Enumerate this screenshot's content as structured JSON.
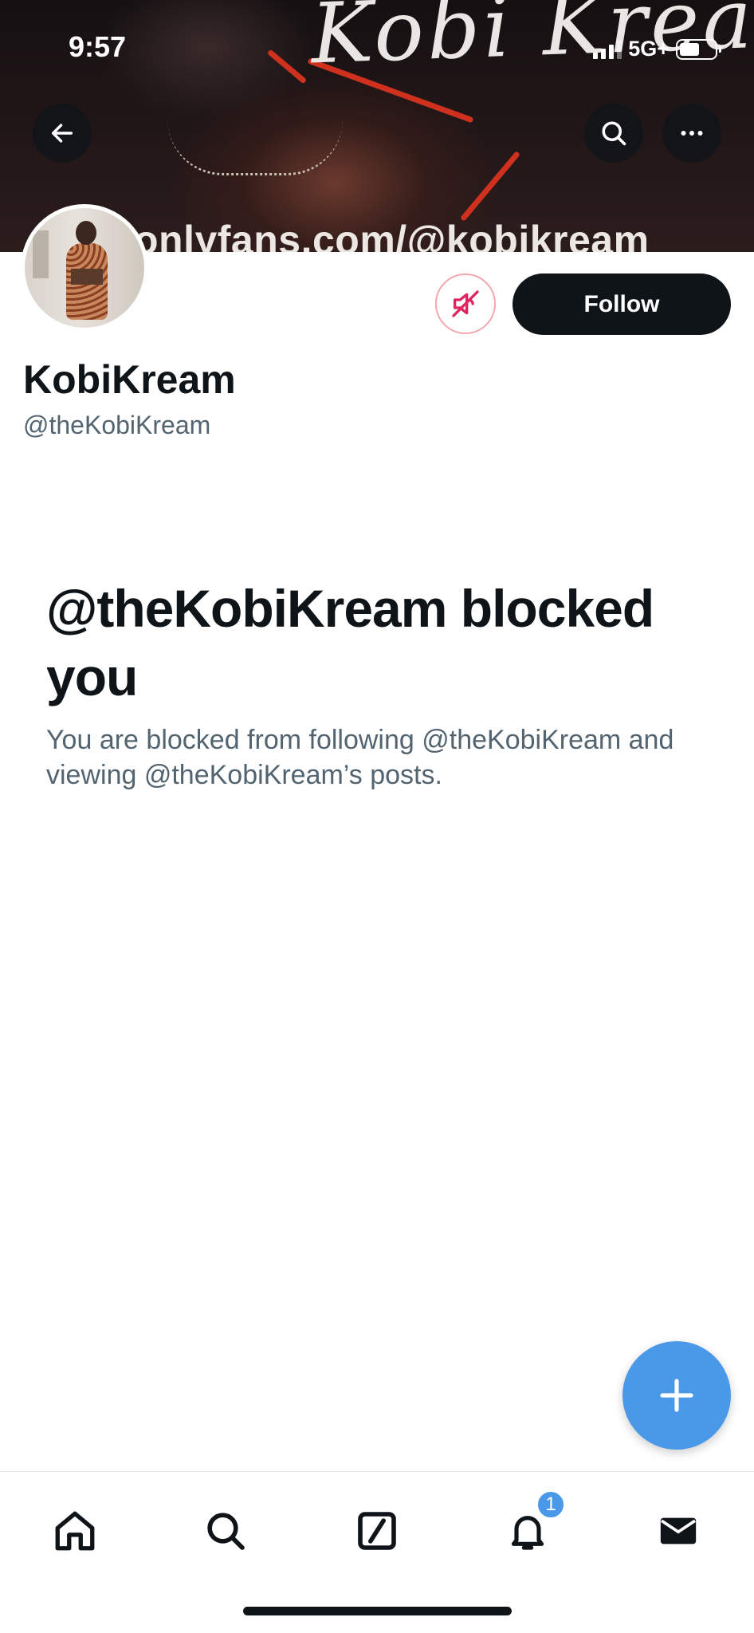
{
  "status_bar": {
    "time": "9:57",
    "network": "5G+",
    "battery_level": 0.58
  },
  "banner": {
    "script_text": "Kobi Kream",
    "watermark_text": "onlyfans.com/@kobikream",
    "icons": {
      "back": "back-arrow-icon",
      "search": "search-icon",
      "more": "more-icon"
    }
  },
  "profile": {
    "display_name": "KobiKream",
    "handle": "@theKobiKream",
    "follow_label": "Follow",
    "muted_icon": "muted-speaker-icon"
  },
  "blocked": {
    "title": "@theKobiKream blocked you",
    "description": "You are blocked from following @theKobiKream and viewing @theKobiKream’s posts."
  },
  "fab": {
    "icon": "plus-icon"
  },
  "tab_bar": {
    "items": [
      {
        "name": "home",
        "icon": "home-icon"
      },
      {
        "name": "search",
        "icon": "search-icon"
      },
      {
        "name": "grok",
        "icon": "grok-icon"
      },
      {
        "name": "notifications",
        "icon": "bell-icon",
        "badge": "1"
      },
      {
        "name": "messages",
        "icon": "mail-icon"
      }
    ]
  },
  "colors": {
    "accent": "#4a99e9",
    "text_primary": "#0f1419",
    "text_secondary": "#536471",
    "mute_border": "#f4a7ae",
    "mute_icon": "#e0245e"
  }
}
